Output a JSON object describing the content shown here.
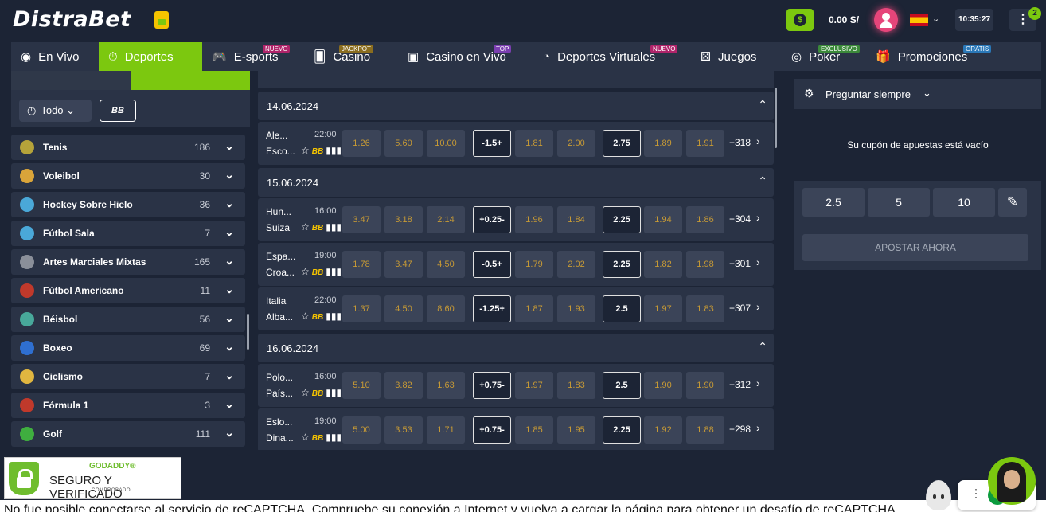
{
  "header": {
    "logo": "DistraBet",
    "balance": "0.00 S/",
    "time": "10:35:27",
    "menu_badge": "2"
  },
  "nav": [
    {
      "label": "En Vivo",
      "icon": "live-broadcast-icon",
      "badge": "",
      "badge_color": ""
    },
    {
      "label": "Deportes",
      "icon": "stopwatch-icon",
      "badge": "",
      "badge_color": "",
      "active": true
    },
    {
      "label": "E-sports",
      "icon": "gamepad-icon",
      "badge": "NUEVO",
      "badge_color": "#b0246a"
    },
    {
      "label": "Casino",
      "icon": "cards-icon",
      "badge": "JACKPOT",
      "badge_color": "#8a6d1f"
    },
    {
      "label": "Casino en Vivo",
      "icon": "dealer-icon",
      "badge": "TOP",
      "badge_color": "#7b3fb0"
    },
    {
      "label": "Deportes Virtuales",
      "icon": "virtual-sports-icon",
      "badge": "NUEVO",
      "badge_color": "#b0246a"
    },
    {
      "label": "Juegos",
      "icon": "dice-icon",
      "badge": "",
      "badge_color": ""
    },
    {
      "label": "Poker",
      "icon": "poker-chip-icon",
      "badge": "EXCLUSIVO",
      "badge_color": "#3b8a3a"
    },
    {
      "label": "Promociones",
      "icon": "gift-icon",
      "badge": "GRATIS",
      "badge_color": "#2a78b8"
    }
  ],
  "sidebar": {
    "filter_label": "Todo",
    "bb_label": "BB",
    "sports": [
      {
        "name": "Tenis",
        "count": "186",
        "color": "#b5a33a"
      },
      {
        "name": "Voleibol",
        "count": "30",
        "color": "#d9a43a"
      },
      {
        "name": "Hockey Sobre Hielo",
        "count": "36",
        "color": "#4aa8d8"
      },
      {
        "name": "Fútbol Sala",
        "count": "7",
        "color": "#4aa8d8"
      },
      {
        "name": "Artes Marciales Mixtas",
        "count": "165",
        "color": "#8a8f99"
      },
      {
        "name": "Fútbol Americano",
        "count": "11",
        "color": "#c0392b"
      },
      {
        "name": "Béisbol",
        "count": "56",
        "color": "#48a89a"
      },
      {
        "name": "Boxeo",
        "count": "69",
        "color": "#2f6fd0"
      },
      {
        "name": "Ciclismo",
        "count": "7",
        "color": "#e0b640"
      },
      {
        "name": "Fórmula 1",
        "count": "3",
        "color": "#c0392b"
      },
      {
        "name": "Golf",
        "count": "111",
        "color": "#3fae3f"
      }
    ]
  },
  "events": {
    "more_prefix": "+",
    "days": [
      {
        "date": "14.06.2024",
        "matches": [
          {
            "home": "Ale...",
            "away": "Esco...",
            "time": "22:00",
            "odds": [
              "1.26",
              "5.60",
              "10.00"
            ],
            "handicap": "-1.5+",
            "h_odds": [
              "1.81",
              "2.00"
            ],
            "total": "2.75",
            "t_odds": [
              "1.89",
              "1.91"
            ],
            "more": "+318"
          }
        ]
      },
      {
        "date": "15.06.2024",
        "matches": [
          {
            "home": "Hun...",
            "away": "Suiza",
            "time": "16:00",
            "odds": [
              "3.47",
              "3.18",
              "2.14"
            ],
            "handicap": "+0.25-",
            "h_odds": [
              "1.96",
              "1.84"
            ],
            "total": "2.25",
            "t_odds": [
              "1.94",
              "1.86"
            ],
            "more": "+304"
          },
          {
            "home": "Espa...",
            "away": "Croa...",
            "time": "19:00",
            "odds": [
              "1.78",
              "3.47",
              "4.50"
            ],
            "handicap": "-0.5+",
            "h_odds": [
              "1.79",
              "2.02"
            ],
            "total": "2.25",
            "t_odds": [
              "1.82",
              "1.98"
            ],
            "more": "+301"
          },
          {
            "home": "Italia",
            "away": "Alba...",
            "time": "22:00",
            "odds": [
              "1.37",
              "4.50",
              "8.60"
            ],
            "handicap": "-1.25+",
            "h_odds": [
              "1.87",
              "1.93"
            ],
            "total": "2.5",
            "t_odds": [
              "1.97",
              "1.83"
            ],
            "more": "+307"
          }
        ]
      },
      {
        "date": "16.06.2024",
        "matches": [
          {
            "home": "Polo...",
            "away": "País...",
            "time": "16:00",
            "odds": [
              "5.10",
              "3.82",
              "1.63"
            ],
            "handicap": "+0.75-",
            "h_odds": [
              "1.97",
              "1.83"
            ],
            "total": "2.5",
            "t_odds": [
              "1.90",
              "1.90"
            ],
            "more": "+312"
          },
          {
            "home": "Eslo...",
            "away": "Dina...",
            "time": "19:00",
            "odds": [
              "5.00",
              "3.53",
              "1.71"
            ],
            "handicap": "+0.75-",
            "h_odds": [
              "1.85",
              "1.95"
            ],
            "total": "2.25",
            "t_odds": [
              "1.92",
              "1.88"
            ],
            "more": "+298"
          }
        ]
      }
    ]
  },
  "coupon": {
    "ask_label": "Preguntar siempre",
    "empty_text": "Su cupón de apuestas está vacío",
    "stakes": [
      "2.5",
      "5",
      "10"
    ],
    "bet_label": "APOSTAR AHORA"
  },
  "badge": {
    "title": "GODADDY®",
    "main": "SEGURO Y VERIFICADO",
    "sub": "COMPROBADO"
  },
  "recaptcha_text": "No fue posible conectarse al servicio de reCAPTCHA. Compruebe su conexión a Internet y vuelva a cargar la página para obtener un desafío de reCAPTCHA."
}
